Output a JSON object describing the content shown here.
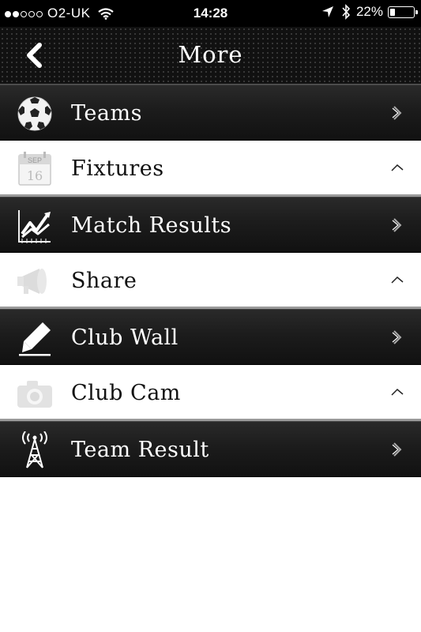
{
  "status_bar": {
    "carrier": "O2-UK",
    "time": "14:28",
    "battery": "22%",
    "battery_level": 0.22,
    "signal_bars_filled": 2,
    "signal_bars_total": 5
  },
  "nav": {
    "title": "More",
    "back_icon": "chevron-left-icon"
  },
  "menu": {
    "items": [
      {
        "label": "Teams",
        "icon": "soccer-ball-icon",
        "style": "dark"
      },
      {
        "label": "Fixtures",
        "icon": "calendar-icon",
        "style": "light"
      },
      {
        "label": "Match Results",
        "icon": "chart-icon",
        "style": "dark"
      },
      {
        "label": "Share",
        "icon": "megaphone-icon",
        "style": "light"
      },
      {
        "label": "Club Wall",
        "icon": "pencil-icon",
        "style": "dark"
      },
      {
        "label": "Club Cam",
        "icon": "camera-icon",
        "style": "light"
      },
      {
        "label": "Team Result",
        "icon": "antenna-icon",
        "style": "dark"
      }
    ]
  },
  "colors": {
    "dark_row": "#1c1c1c",
    "light_row": "#ffffff",
    "separator": "#9a9a9a"
  }
}
